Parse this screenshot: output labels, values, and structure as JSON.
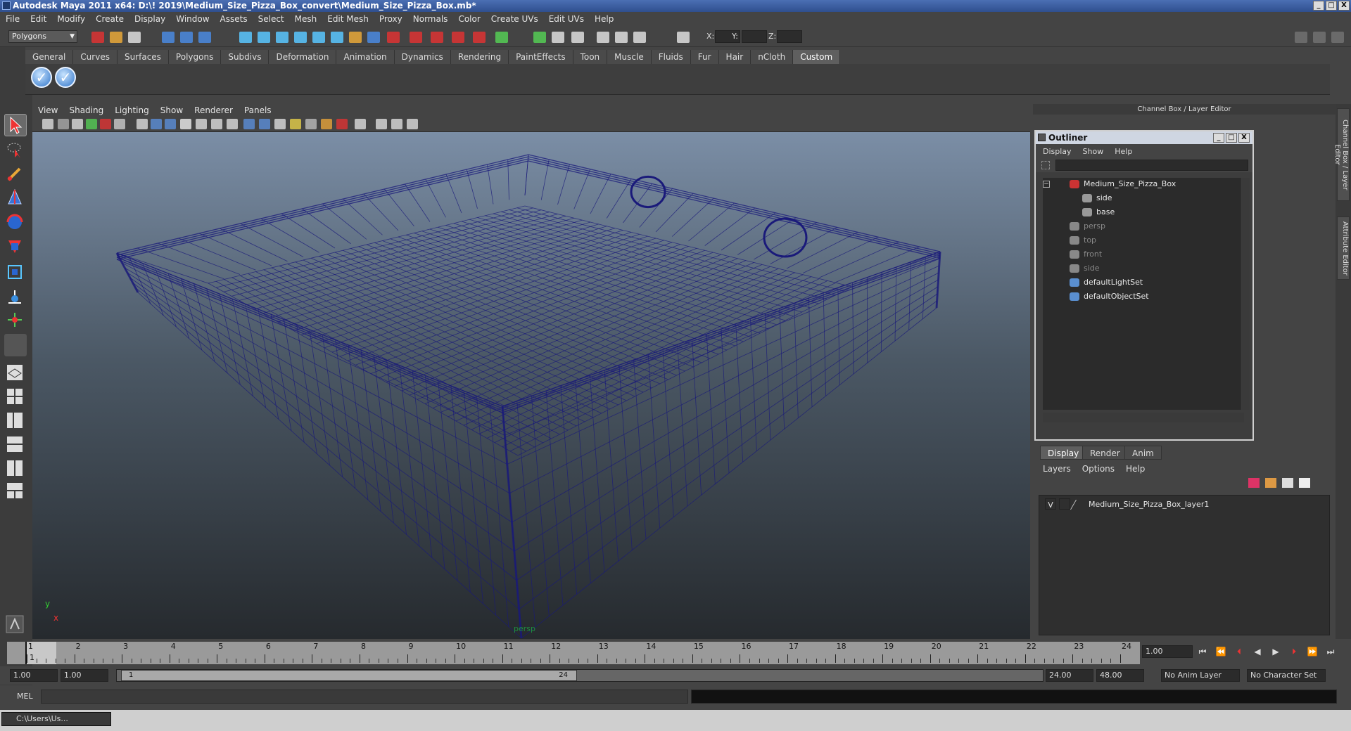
{
  "window": {
    "title": "Autodesk Maya 2011 x64: D:\\! 2019\\Medium_Size_Pizza_Box_convert\\Medium_Size_Pizza_Box.mb*",
    "buttons": [
      "_",
      "□",
      "X"
    ]
  },
  "menubar": [
    "File",
    "Edit",
    "Modify",
    "Create",
    "Display",
    "Window",
    "Assets",
    "Select",
    "Mesh",
    "Edit Mesh",
    "Proxy",
    "Normals",
    "Color",
    "Create UVs",
    "Edit UVs",
    "Help"
  ],
  "statusline": {
    "mode": "Polygons",
    "x_label": "X:",
    "y_label": "Y:",
    "z_label": "Z:"
  },
  "shelf": {
    "tabs": [
      "General",
      "Curves",
      "Surfaces",
      "Polygons",
      "Subdivs",
      "Deformation",
      "Animation",
      "Dynamics",
      "Rendering",
      "PaintEffects",
      "Toon",
      "Muscle",
      "Fluids",
      "Fur",
      "Hair",
      "nCloth",
      "Custom"
    ],
    "active_tab": "Custom"
  },
  "viewport": {
    "menu": [
      "View",
      "Shading",
      "Lighting",
      "Show",
      "Renderer",
      "Panels"
    ],
    "camera_label": "persp",
    "axis_y": "y",
    "axis_x": "x",
    "wire_color": "#1a1a7a"
  },
  "channel_box": {
    "title": "Channel Box / Layer Editor",
    "side_tabs": [
      "Channel Box / Layer Editor",
      "Attribute Editor"
    ]
  },
  "outliner": {
    "title": "Outliner",
    "menu": [
      "Display",
      "Show",
      "Help"
    ],
    "items": [
      {
        "label": "Medium_Size_Pizza_Box",
        "indent": 0,
        "dim": false,
        "icon": "transform-icon"
      },
      {
        "label": "side",
        "indent": 1,
        "dim": false,
        "icon": "mesh-icon"
      },
      {
        "label": "base",
        "indent": 1,
        "dim": false,
        "icon": "mesh-icon"
      },
      {
        "label": "persp",
        "indent": 0,
        "dim": true,
        "icon": "camera-icon"
      },
      {
        "label": "top",
        "indent": 0,
        "dim": true,
        "icon": "camera-icon"
      },
      {
        "label": "front",
        "indent": 0,
        "dim": true,
        "icon": "camera-icon"
      },
      {
        "label": "side",
        "indent": 0,
        "dim": true,
        "icon": "camera-icon"
      },
      {
        "label": "defaultLightSet",
        "indent": 0,
        "dim": false,
        "icon": "set-icon"
      },
      {
        "label": "defaultObjectSet",
        "indent": 0,
        "dim": false,
        "icon": "set-icon"
      }
    ]
  },
  "layer_editor": {
    "tabs": [
      "Display",
      "Render",
      "Anim"
    ],
    "active_tab": "Display",
    "menu": [
      "Layers",
      "Options",
      "Help"
    ],
    "layers": [
      {
        "visible": "V",
        "name": "Medium_Size_Pizza_Box_layer1"
      }
    ]
  },
  "timeline": {
    "ticks": [
      "1",
      "2",
      "3",
      "4",
      "5",
      "6",
      "7",
      "8",
      "9",
      "10",
      "11",
      "12",
      "13",
      "14",
      "15",
      "16",
      "17",
      "18",
      "19",
      "20",
      "21",
      "22",
      "23",
      "24"
    ],
    "current_frame": "1",
    "current_time": "1.00"
  },
  "range": {
    "start": "1.00",
    "playback_start": "1.00",
    "knob_start": "1",
    "knob_end": "24",
    "playback_end": "24.00",
    "end": "48.00",
    "anim_layer": "No Anim Layer",
    "character_set": "No Character Set"
  },
  "command_line": {
    "label": "MEL"
  },
  "taskbar": {
    "item": "C:\\Users\\Us..."
  }
}
